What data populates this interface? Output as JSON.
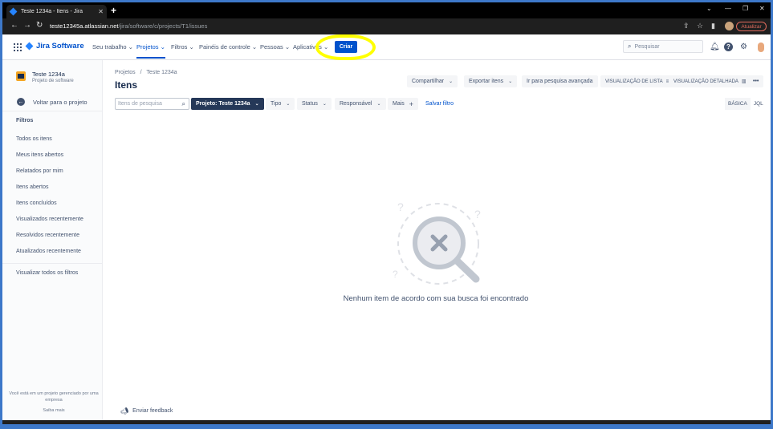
{
  "browser": {
    "tab_title": "Teste 1234a - Itens - Jira",
    "url_host": "teste12345a.atlassian.net",
    "url_path": "/jira/software/c/projects/T1/issues",
    "update_label": "Atualizar"
  },
  "topnav": {
    "logo_text": "Jira Software",
    "items": [
      "Seu trabalho",
      "Projetos",
      "Filtros",
      "Painéis de controle",
      "Pessoas",
      "Aplicativos"
    ],
    "create_label": "Criar",
    "search_placeholder": "Pesquisar"
  },
  "sidebar": {
    "project_name": "Teste 1234a",
    "project_type": "Projeto de software",
    "back_label": "Voltar para o projeto",
    "filters_heading": "Filtros",
    "items": [
      "Todos os itens",
      "Meus itens abertos",
      "Relatados por mim",
      "Itens abertos",
      "Itens concluídos",
      "Visualizados recentemente",
      "Resolvidos recentemente",
      "Atualizados recentemente"
    ],
    "view_all_filters": "Visualizar todos os filtros",
    "footer_line": "Você está em um projeto gerenciado por uma empresa",
    "learn_more": "Saiba mais"
  },
  "main": {
    "breadcrumb_root": "Projetos",
    "breadcrumb_sep": "/",
    "breadcrumb_project": "Teste 1234a",
    "title": "Itens",
    "actions": {
      "share": "Compartilhar",
      "export": "Exportar itens",
      "advanced": "Ir para pesquisa avançada",
      "list_view": "VISUALIZAÇÃO DE LISTA",
      "detail_view": "VISUALIZAÇÃO DETALHADA",
      "more": "•••"
    },
    "filters": {
      "search_placeholder": "Itens de pesquisa",
      "project": "Projeto: Teste 1234a",
      "type": "Tipo",
      "status": "Status",
      "assignee": "Responsável",
      "more": "Mais",
      "save": "Salvar filtro",
      "basic": "BÁSICA",
      "jql": "JQL"
    },
    "empty_message": "Nenhum item de acordo com sua busca foi encontrado",
    "feedback": "Enviar feedback"
  },
  "colors": {
    "primary": "#0052cc",
    "dark_button": "#253858",
    "highlight": "#ffff00"
  }
}
